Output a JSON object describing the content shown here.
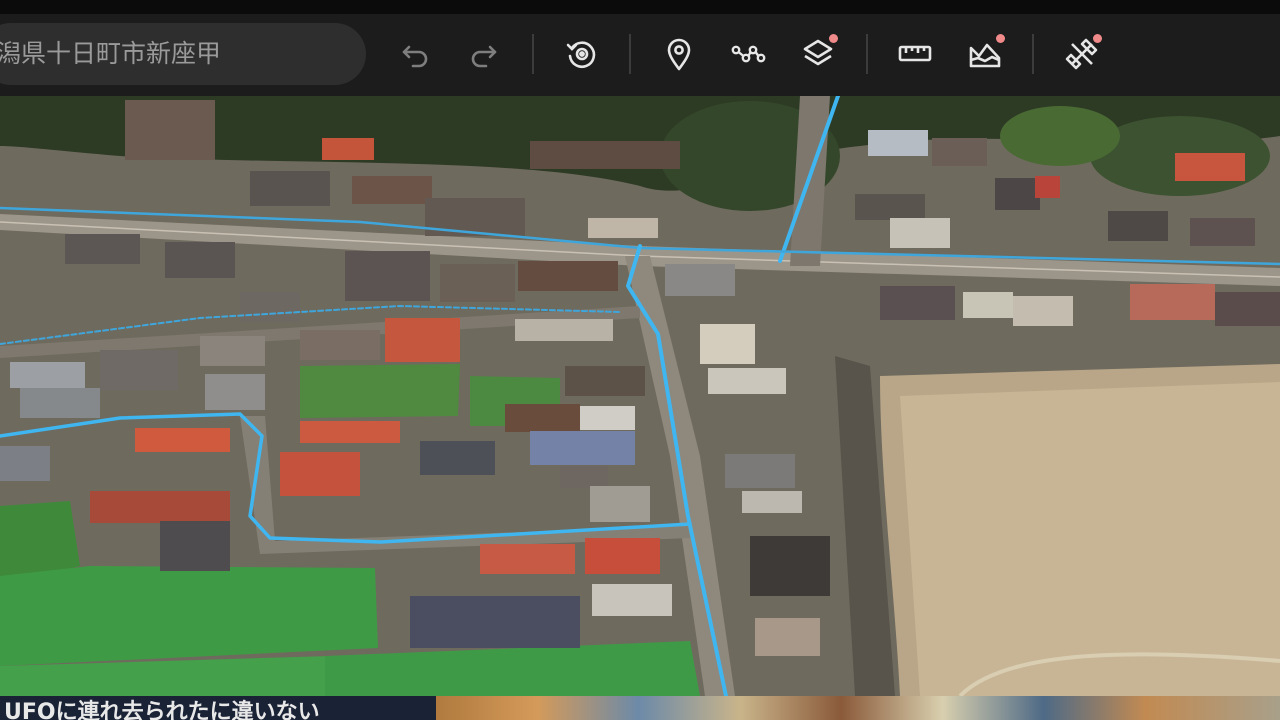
{
  "toolbar": {
    "search_text": "潟県十日町市新座甲",
    "buttons": [
      {
        "icon": "undo-icon"
      },
      {
        "icon": "redo-icon"
      },
      {
        "icon": "replay-icon"
      },
      {
        "icon": "location-pin-icon"
      },
      {
        "icon": "path-icon"
      },
      {
        "icon": "layers-icon",
        "badge": true
      },
      {
        "icon": "ruler-icon"
      },
      {
        "icon": "terrain-icon",
        "badge": true
      },
      {
        "icon": "tools-icon",
        "badge": true
      }
    ],
    "badge_color": "#f08a8a"
  },
  "map": {
    "type": "satellite-3d",
    "route_color": "#3fb6f0"
  },
  "caption": {
    "text": "UFOに連れ去られたに違いない"
  }
}
